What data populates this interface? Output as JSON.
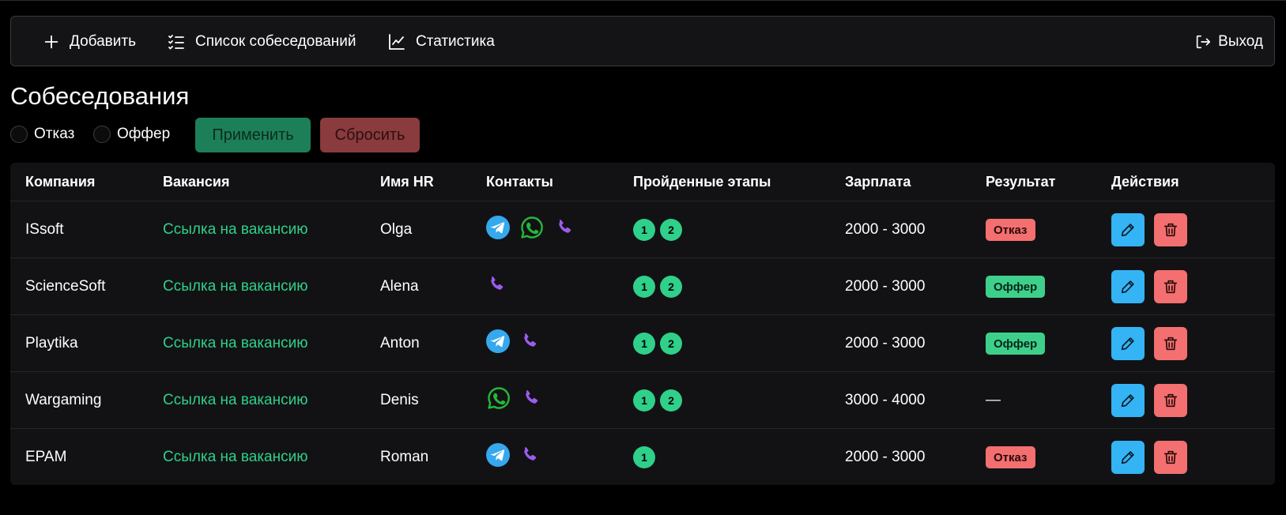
{
  "nav": {
    "add": "Добавить",
    "list": "Список собеседований",
    "stats": "Статистика",
    "logout": "Выход"
  },
  "page": {
    "title": "Собеседования"
  },
  "filters": {
    "refuse": "Отказ",
    "offer": "Оффер",
    "apply": "Применить",
    "reset": "Сбросить"
  },
  "table": {
    "headers": [
      "Компания",
      "Вакансия",
      "Имя HR",
      "Контакты",
      "Пройденные этапы",
      "Зарплата",
      "Результат",
      "Действия"
    ],
    "rows": [
      {
        "company": "ISsoft",
        "vacancy": "Ссылка на вакансию",
        "hr": "Olga",
        "contacts": [
          "telegram",
          "whatsapp",
          "phone"
        ],
        "stages": [
          "1",
          "2"
        ],
        "salary": "2000 - 3000",
        "result": "Отказ",
        "result_type": "refuse"
      },
      {
        "company": "ScienceSoft",
        "vacancy": "Ссылка на вакансию",
        "hr": "Alena",
        "contacts": [
          "phone"
        ],
        "stages": [
          "1",
          "2"
        ],
        "salary": "2000 - 3000",
        "result": "Оффер",
        "result_type": "offer"
      },
      {
        "company": "Playtika",
        "vacancy": "Ссылка на вакансию",
        "hr": "Anton",
        "contacts": [
          "telegram",
          "phone"
        ],
        "stages": [
          "1",
          "2"
        ],
        "salary": "2000 - 3000",
        "result": "Оффер",
        "result_type": "offer"
      },
      {
        "company": "Wargaming",
        "vacancy": "Ссылка на вакансию",
        "hr": "Denis",
        "contacts": [
          "whatsapp",
          "phone"
        ],
        "stages": [
          "1",
          "2"
        ],
        "salary": "3000 - 4000",
        "result": "—",
        "result_type": "none"
      },
      {
        "company": "EPAM",
        "vacancy": "Ссылка на вакансию",
        "hr": "Roman",
        "contacts": [
          "telegram",
          "phone"
        ],
        "stages": [
          "1"
        ],
        "salary": "2000 - 3000",
        "result": "Отказ",
        "result_type": "refuse"
      }
    ]
  },
  "colors": {
    "accent_green": "#2fd08a",
    "edit_blue": "#34b4f4",
    "delete_red": "#f36f70",
    "telegram": "#35a8ee",
    "whatsapp": "#25b83a",
    "phone": "#9b5cf0"
  }
}
